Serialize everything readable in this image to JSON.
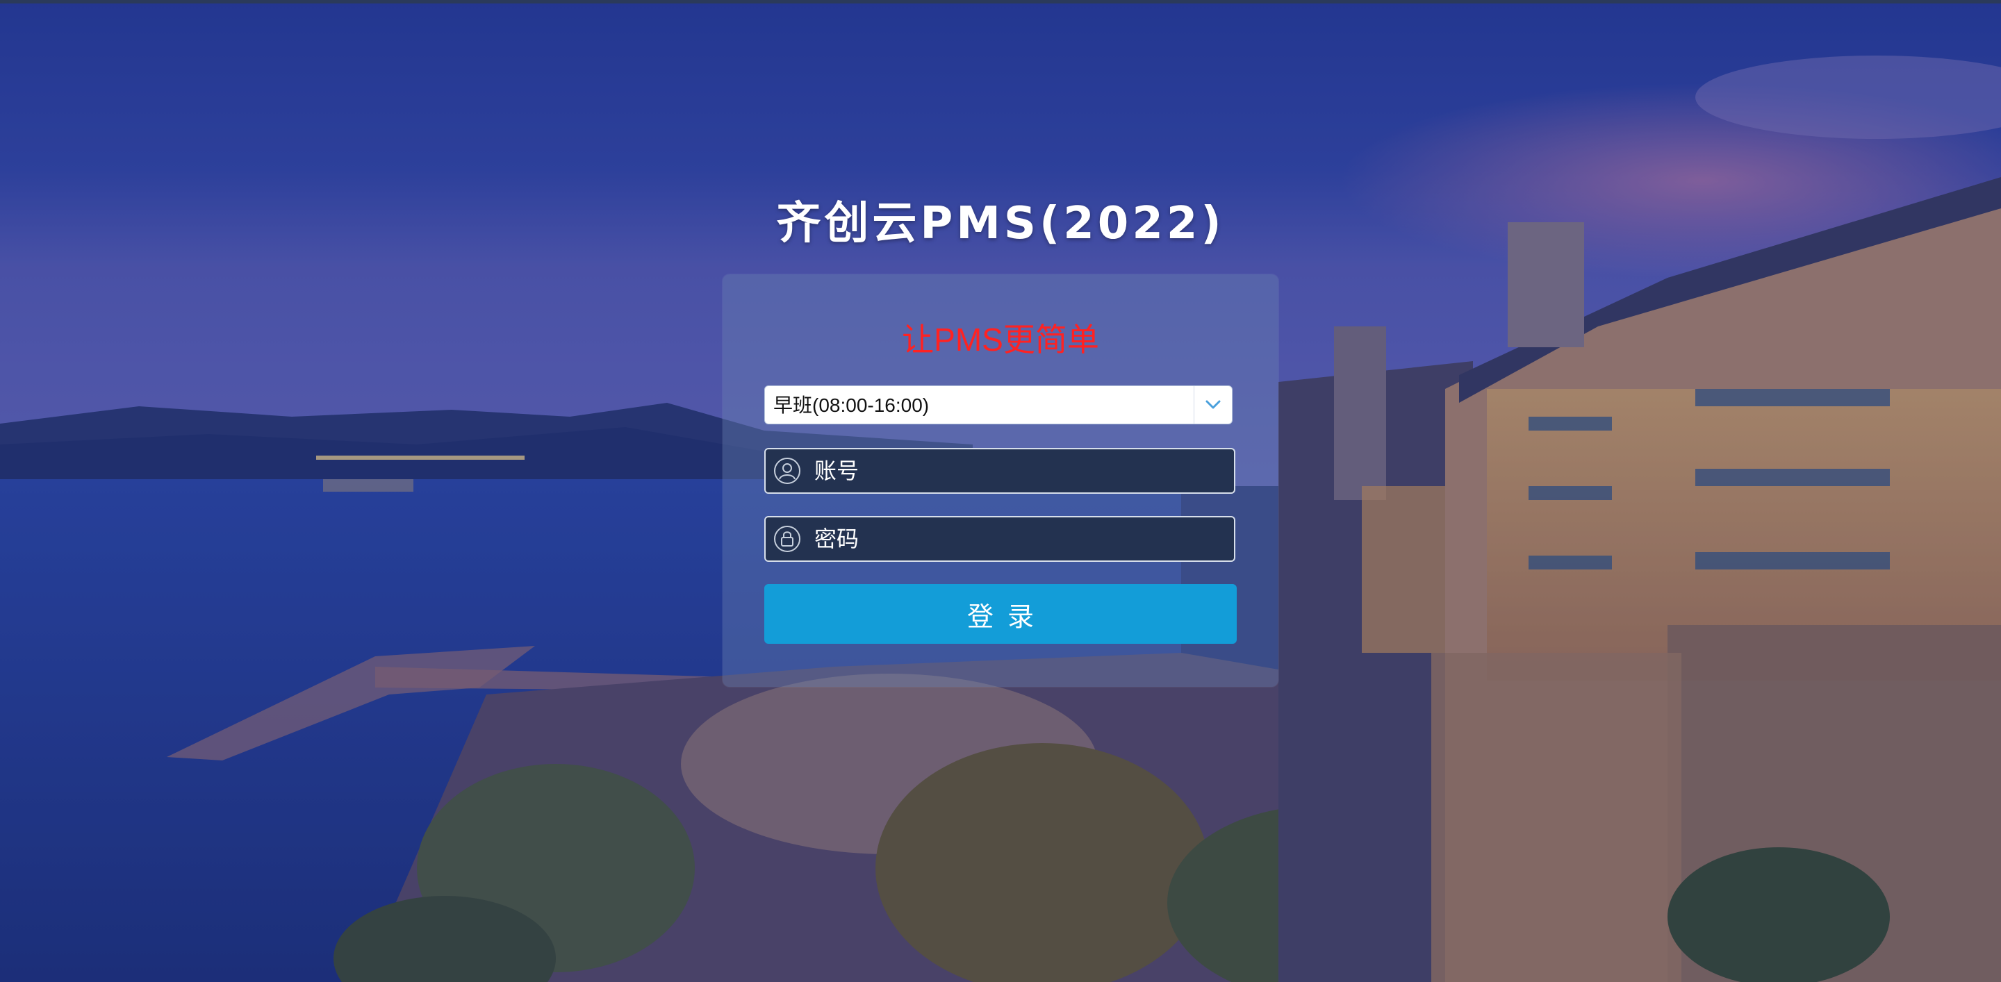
{
  "app": {
    "title": "齐创云PMS(2022)"
  },
  "login": {
    "slogan": "让PMS更简单",
    "shift": {
      "selected": "早班(08:00-16:00)",
      "icon": "chevron-down-icon"
    },
    "account": {
      "placeholder": "账号",
      "icon": "user-icon"
    },
    "password": {
      "placeholder": "密码",
      "icon": "lock-icon"
    },
    "submit_label": "登录"
  },
  "colors": {
    "slogan": "#ff2222",
    "button": "#139dd8",
    "input_bg": "#233250"
  }
}
